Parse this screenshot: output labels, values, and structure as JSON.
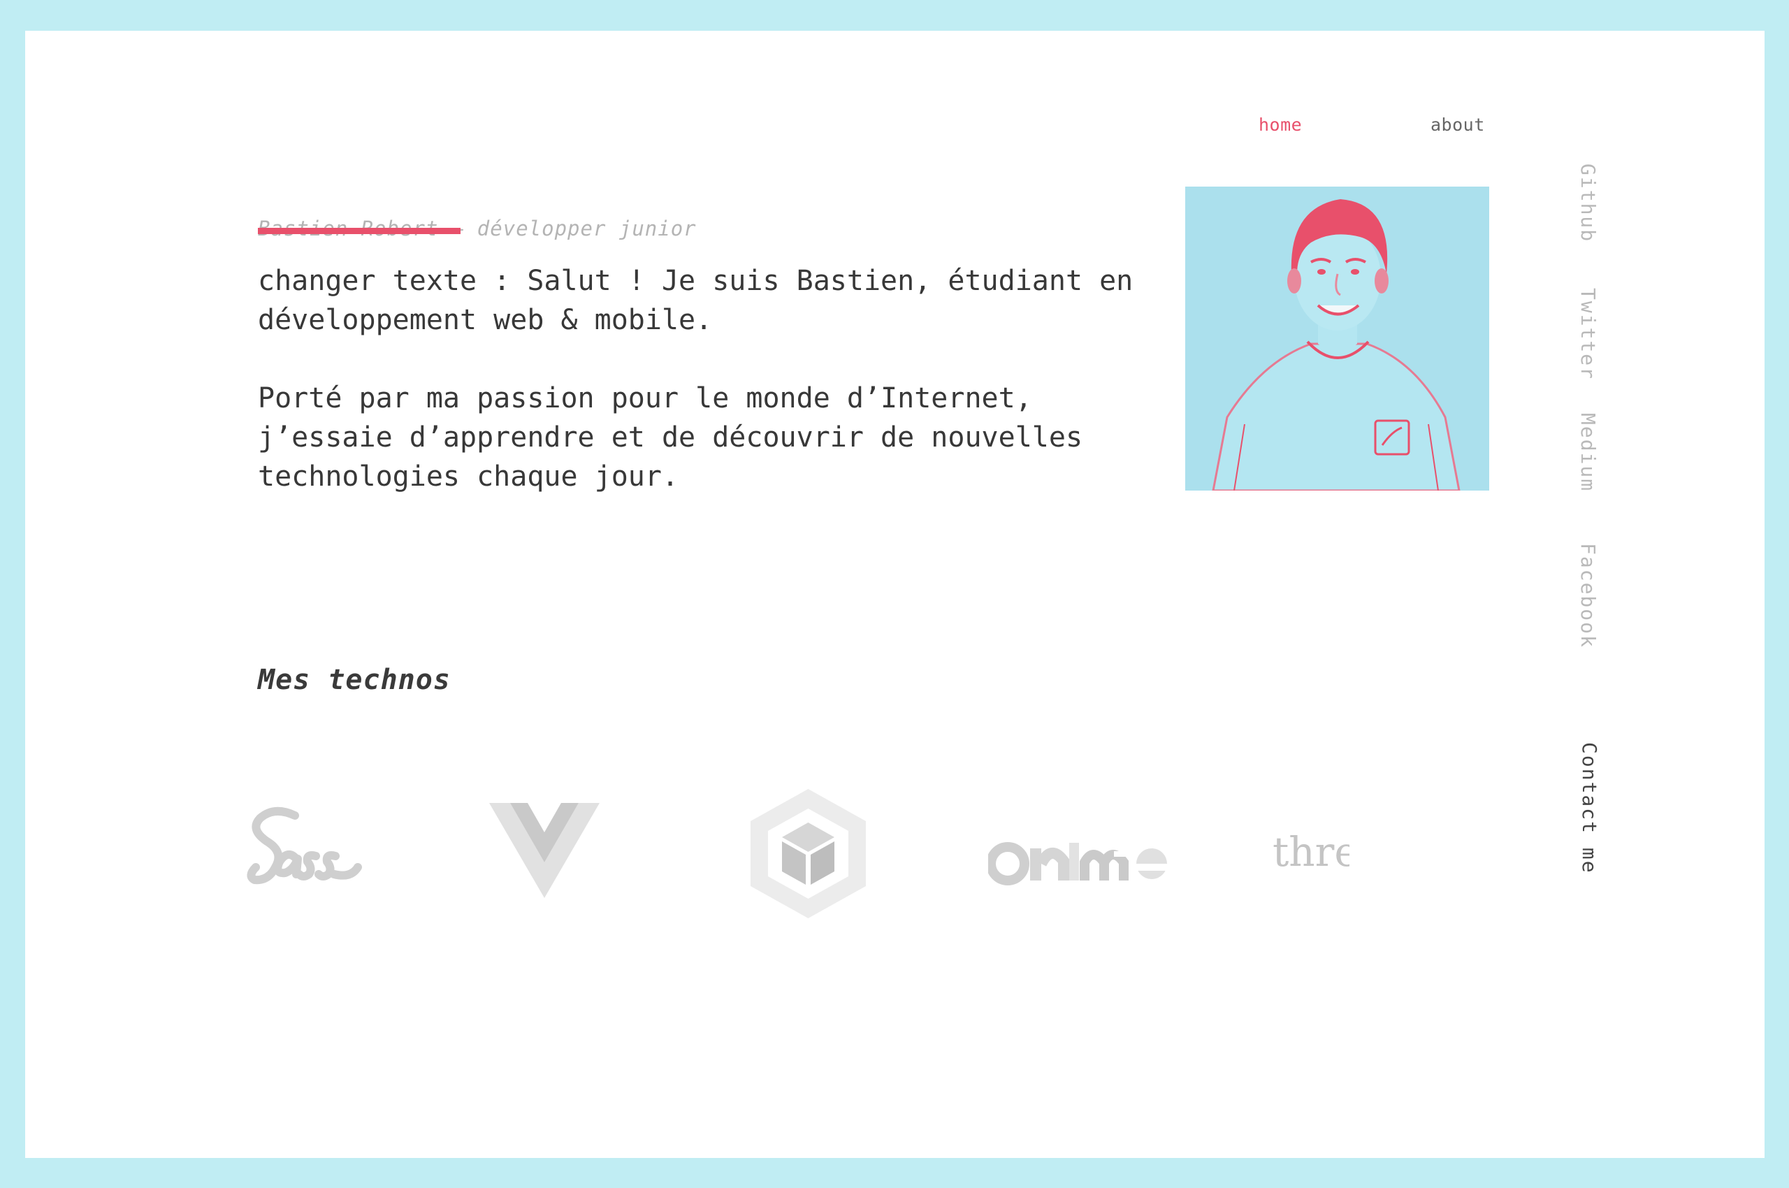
{
  "nav": {
    "home": "home",
    "about": "about"
  },
  "hero": {
    "subtitle": "Bastien Robert — développer junior",
    "paragraph_1": "changer texte : Salut ! Je suis Bastien, étudiant en\ndéveloppement web & mobile.",
    "paragraph_2": "Porté par ma passion pour le monde d’Internet,\nj’essaie d’apprendre et de découvrir de nouvelles\ntechnologies chaque jour."
  },
  "social": {
    "github": "Github",
    "twitter": "Twitter",
    "medium": "Medium",
    "facebook": "Facebook",
    "contact": "Contact me"
  },
  "techs": {
    "title": "Mes technos",
    "logos": [
      {
        "name": "Sass",
        "icon": "sass-logo"
      },
      {
        "name": "Vue",
        "icon": "vue-logo"
      },
      {
        "name": "webpack",
        "icon": "webpack-logo"
      },
      {
        "name": "anime",
        "icon": "anime-logo"
      },
      {
        "name": "three",
        "icon": "three-logo"
      }
    ],
    "three_label": "thre"
  },
  "colors": {
    "frame_border": "#c0edf3",
    "accent": "#e8506b",
    "photo_bg": "#abe0ed",
    "logo_gray": "#c8c8c8"
  }
}
